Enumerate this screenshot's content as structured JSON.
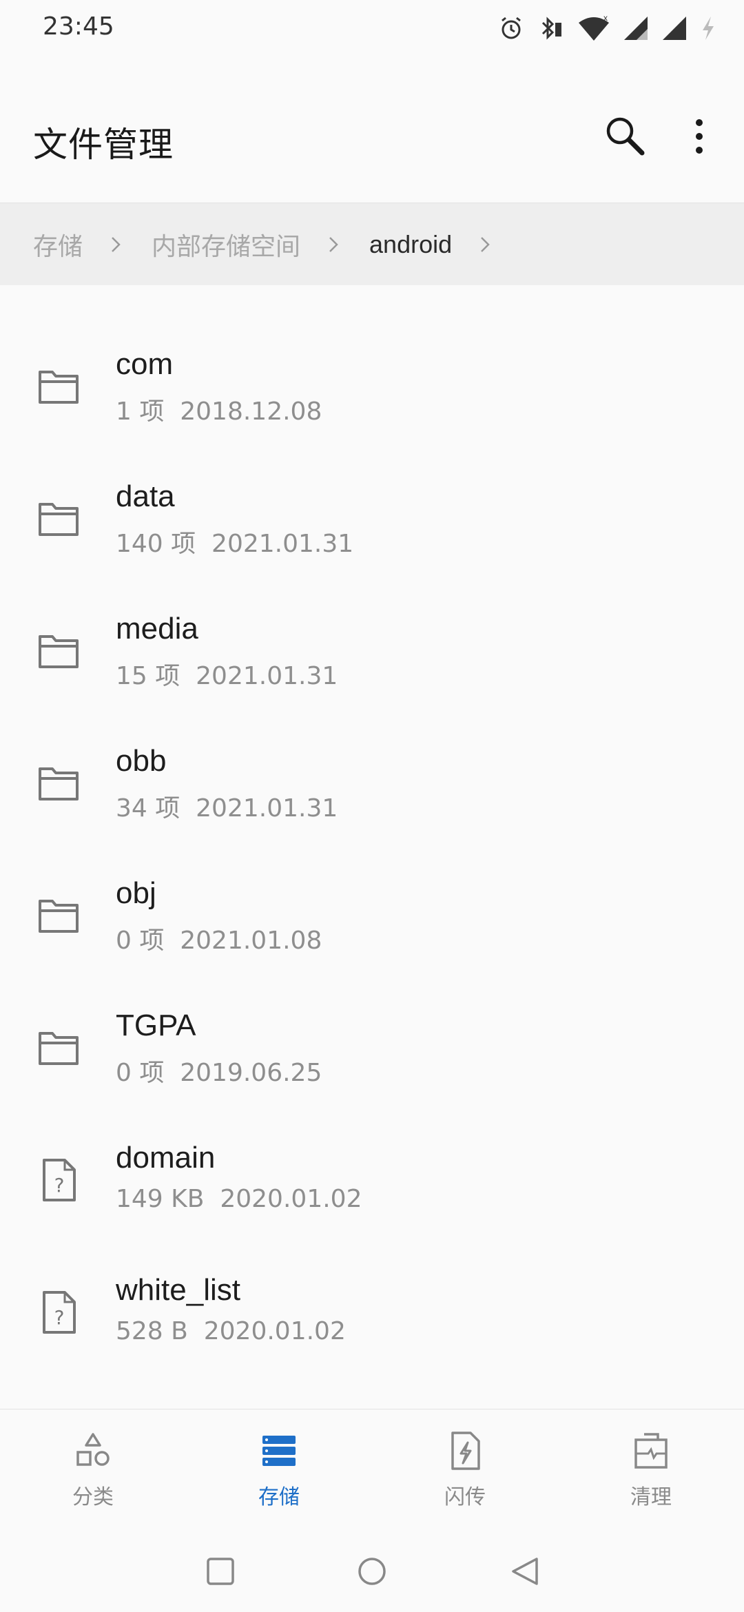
{
  "status_bar": {
    "time": "23:45"
  },
  "app_bar": {
    "title": "文件管理"
  },
  "breadcrumb": {
    "items": [
      "存储",
      "内部存储空间",
      "android"
    ]
  },
  "files": [
    {
      "name": "com",
      "meta": "1 项  2018.12.08",
      "type": "folder"
    },
    {
      "name": "data",
      "meta": "140 项  2021.01.31",
      "type": "folder"
    },
    {
      "name": "media",
      "meta": "15 项  2021.01.31",
      "type": "folder"
    },
    {
      "name": "obb",
      "meta": "34 项  2021.01.31",
      "type": "folder"
    },
    {
      "name": "obj",
      "meta": "0 项  2021.01.08",
      "type": "folder"
    },
    {
      "name": "TGPA",
      "meta": "0 项  2019.06.25",
      "type": "folder"
    },
    {
      "name": "domain",
      "meta": "149 KB  2020.01.02",
      "type": "unknown-file"
    },
    {
      "name": "white_list",
      "meta": "528 B  2020.01.02",
      "type": "unknown-file"
    }
  ],
  "bottom_nav": {
    "items": [
      {
        "label": "分类",
        "icon": "category-icon",
        "active": false
      },
      {
        "label": "存储",
        "icon": "storage-icon",
        "active": true
      },
      {
        "label": "闪传",
        "icon": "flash-transfer-icon",
        "active": false
      },
      {
        "label": "清理",
        "icon": "clean-icon",
        "active": false
      }
    ]
  },
  "colors": {
    "accent": "#1e6fc8",
    "background": "#fafafa",
    "breadcrumb_bg": "#eeeeee",
    "secondary_text": "#8e8e8e"
  }
}
